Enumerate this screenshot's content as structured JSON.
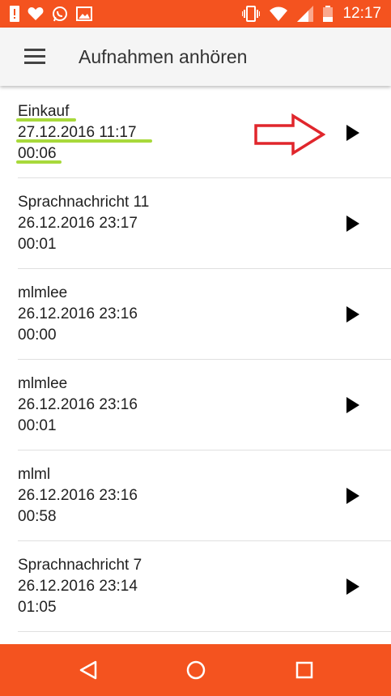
{
  "status_bar": {
    "time": "12:17",
    "left_icons": [
      "alert-icon",
      "heart-icon",
      "whatsapp-icon",
      "image-icon"
    ],
    "right_icons": [
      "vibrate-icon",
      "wifi-icon",
      "signal-icon",
      "battery-icon"
    ]
  },
  "header": {
    "title": "Aufnahmen anhören",
    "menu_icon": "hamburger-icon"
  },
  "recordings": [
    {
      "name": "Einkauf",
      "date": "27.12.2016 11:17",
      "duration": "00:06"
    },
    {
      "name": "Sprachnachricht 11",
      "date": "26.12.2016 23:17",
      "duration": "00:01"
    },
    {
      "name": "mlmlee",
      "date": "26.12.2016 23:16",
      "duration": "00:00"
    },
    {
      "name": "mlmlee",
      "date": "26.12.2016 23:16",
      "duration": "00:01"
    },
    {
      "name": "mlml",
      "date": "26.12.2016 23:16",
      "duration": "00:58"
    },
    {
      "name": "Sprachnachricht 7",
      "date": "26.12.2016 23:14",
      "duration": "01:05"
    }
  ],
  "annotations": {
    "arrow_color": "#e0262c",
    "highlight_color": "#a8d93b"
  },
  "colors": {
    "accent": "#f4531f",
    "appbar": "#f5f5f5"
  },
  "nav_bar": {
    "buttons": [
      "back-icon",
      "home-icon",
      "recents-icon"
    ]
  }
}
